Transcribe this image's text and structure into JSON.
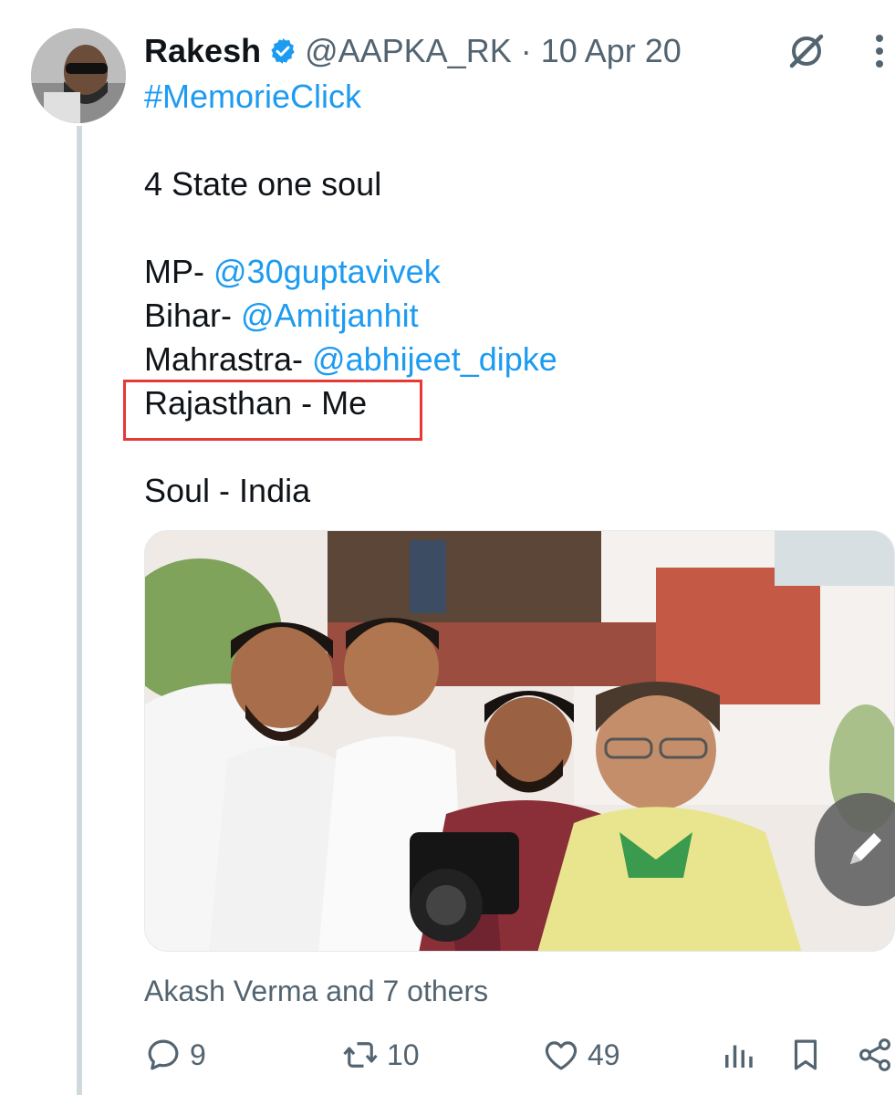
{
  "tweet": {
    "author_name": "Rakesh",
    "handle_line": "@AAPKA_RK · 10 Apr 20",
    "hashtag": "#MemorieClick",
    "lines": {
      "l1": "4 State one soul",
      "mp_label": "MP- ",
      "mp_mention": "@30guptavivek",
      "bihar_label": "Bihar- ",
      "bihar_mention": "@Amitjanhit",
      "mah_label": "Mahrastra- ",
      "mah_mention": "@abhijeet_dipke",
      "raj": "Rajasthan - Me",
      "soul": "Soul - India"
    },
    "tagged": "Akash Verma and 7 others",
    "counts": {
      "replies": "9",
      "retweets": "10",
      "likes": "49"
    }
  },
  "colors": {
    "link": "#1d9bf0",
    "muted": "#536471",
    "highlight": "#e53935",
    "verified": "#1d9bf0"
  },
  "icons": [
    "grok-icon",
    "more-icon",
    "verified-icon",
    "reply-icon",
    "retweet-icon",
    "like-icon",
    "views-icon",
    "bookmark-icon",
    "share-icon",
    "edit-icon"
  ]
}
